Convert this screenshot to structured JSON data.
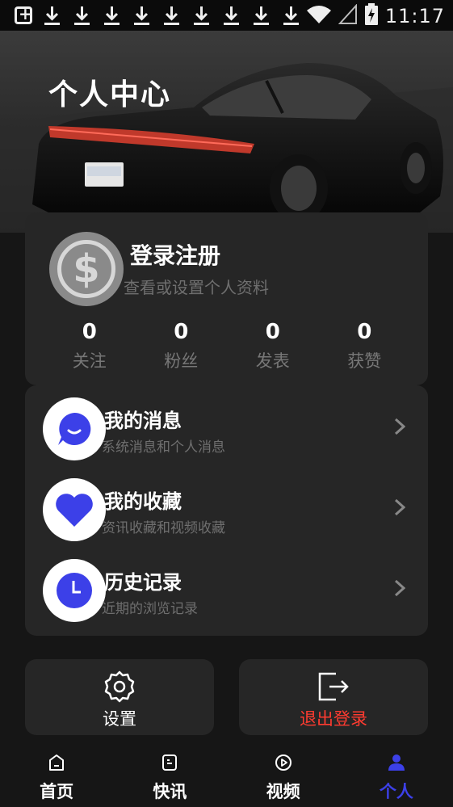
{
  "status_bar": {
    "time": "11:17",
    "icons": [
      "screenshot-icon",
      "download-icon",
      "download-icon",
      "download-icon",
      "download-icon",
      "download-icon",
      "download-icon",
      "download-icon",
      "download-icon",
      "download-icon",
      "wifi-icon",
      "signal-icon",
      "battery-charging-icon"
    ]
  },
  "header": {
    "title": "个人中心"
  },
  "profile": {
    "avatar_icon": "dollar-icon",
    "login_label": "登录注册",
    "subtitle": "查看或设置个人资料",
    "stats": [
      {
        "value": "0",
        "label": "关注"
      },
      {
        "value": "0",
        "label": "粉丝"
      },
      {
        "value": "0",
        "label": "发表"
      },
      {
        "value": "0",
        "label": "获赞"
      }
    ]
  },
  "menu": {
    "items": [
      {
        "title": "我的消息",
        "subtitle": "系统消息和个人消息",
        "icon": "message-icon"
      },
      {
        "title": "我的收藏",
        "subtitle": "资讯收藏和视频收藏",
        "icon": "heart-icon"
      },
      {
        "title": "历史记录",
        "subtitle": "近期的浏览记录",
        "icon": "clock-icon"
      }
    ]
  },
  "actions": {
    "settings_label": "设置",
    "logout_label": "退出登录"
  },
  "bottom_nav": {
    "items": [
      {
        "label": "首页",
        "icon": "home-icon"
      },
      {
        "label": "快讯",
        "icon": "news-icon"
      },
      {
        "label": "视频",
        "icon": "video-icon"
      },
      {
        "label": "个人",
        "icon": "person-icon"
      }
    ],
    "active_index": 3
  },
  "colors": {
    "background": "#161616",
    "card": "#262626",
    "accent": "#3c40e8",
    "logout_text": "#ff3b30",
    "muted_text": "#6f6f6f"
  }
}
